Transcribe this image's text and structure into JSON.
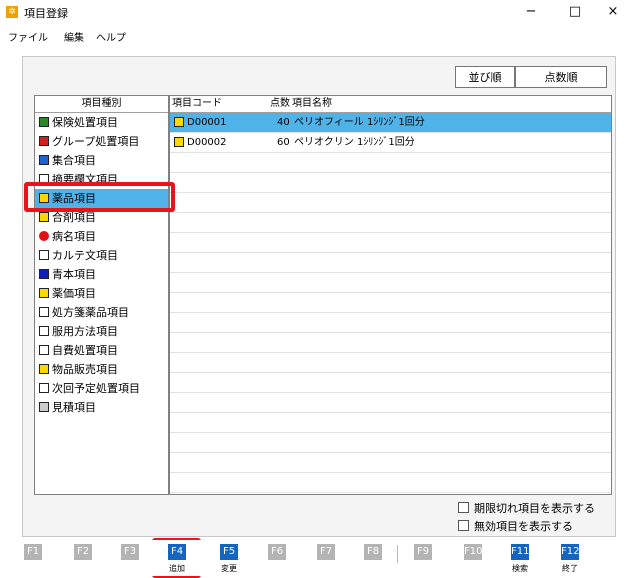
{
  "window": {
    "title": "項目登録",
    "minimize": "−",
    "maximize": "□",
    "close": "×"
  },
  "menu": [
    "ファイル",
    "編集",
    "ヘルプ"
  ],
  "sort_buttons": {
    "order": "並び順",
    "score": "点数順"
  },
  "category_header": "項目種別",
  "categories": [
    {
      "label": "保険処置項目",
      "icon": "green-square-icon",
      "color": "#2a8a2a"
    },
    {
      "label": "グループ処置項目",
      "icon": "red-yellow-square-icon",
      "color": "#d02020"
    },
    {
      "label": "集合項目",
      "icon": "colorful-shapes-icon",
      "color": "#2060d0"
    },
    {
      "label": "摘要欄文項目",
      "icon": "pencil-note-icon",
      "color": "#ffffff"
    },
    {
      "label": "薬品項目",
      "icon": "medicine-note-icon",
      "color": "#ffd700"
    },
    {
      "label": "合剤項目",
      "icon": "mixture-icon",
      "color": "#ffd700"
    },
    {
      "label": "病名項目",
      "icon": "red-circle-icon",
      "color": "#e01010"
    },
    {
      "label": "カルテ文項目",
      "icon": "chart-note-icon",
      "color": "#ffffff"
    },
    {
      "label": "青本項目",
      "icon": "blue-book-icon",
      "color": "#1020c0"
    },
    {
      "label": "薬価項目",
      "icon": "price-note-icon",
      "color": "#ffd700"
    },
    {
      "label": "処方箋薬品項目",
      "icon": "prescription-icon",
      "color": "#ffffff"
    },
    {
      "label": "服用方法項目",
      "icon": "dosage-note-icon",
      "color": "#ffffff"
    },
    {
      "label": "自費処置項目",
      "icon": "self-pay-icon",
      "color": "#ffffff"
    },
    {
      "label": "物品販売項目",
      "icon": "sale-item-icon",
      "color": "#ffd700"
    },
    {
      "label": "次回予定処置項目",
      "icon": "next-plan-icon",
      "color": "#ffffff"
    },
    {
      "label": "見積項目",
      "icon": "estimate-grid-icon",
      "color": "#cccccc"
    }
  ],
  "grid_headers": {
    "code": "項目コード",
    "score": "点数",
    "name": "項目名称"
  },
  "rows": [
    {
      "code": "D00001",
      "score": "40",
      "name": "ペリオフィール 1ｼﾘﾝｼﾞ1回分"
    },
    {
      "code": "D00002",
      "score": "60",
      "name": "ペリオクリン 1ｼﾘﾝｼﾞ1回分"
    }
  ],
  "checkboxes": {
    "expired": "期限切れ項目を表示する",
    "invalid": "無効項目を表示する"
  },
  "fkeys": [
    {
      "key": "F1",
      "label": ""
    },
    {
      "key": "F2",
      "label": ""
    },
    {
      "key": "F3",
      "label": ""
    },
    {
      "key": "F4",
      "label": "追加"
    },
    {
      "key": "F5",
      "label": "変更"
    },
    {
      "key": "F6",
      "label": ""
    },
    {
      "key": "F7",
      "label": ""
    },
    {
      "key": "F8",
      "label": ""
    },
    {
      "key": "F9",
      "label": ""
    },
    {
      "key": "F10",
      "label": ""
    },
    {
      "key": "F11",
      "label": "検索"
    },
    {
      "key": "F12",
      "label": "終了"
    }
  ],
  "colors": {
    "selection": "#4fb2e8",
    "fkey_active": "#1565c0",
    "fkey_inactive": "#b4b4b4",
    "highlight": "#e8141c"
  }
}
